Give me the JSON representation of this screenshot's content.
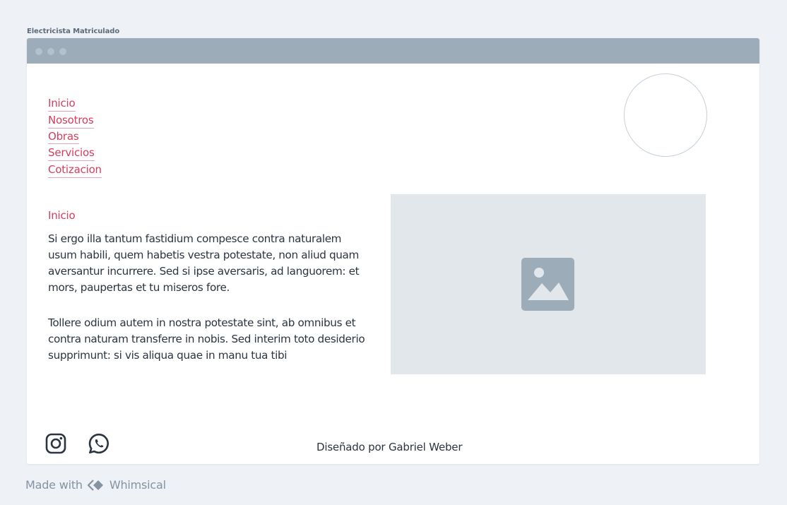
{
  "board": {
    "title": "Electricista Matriculado"
  },
  "window": {
    "titlebar_color": "#9dacb9"
  },
  "nav": {
    "items": [
      {
        "label": "Inicio"
      },
      {
        "label": "Nosotros"
      },
      {
        "label": "Obras"
      },
      {
        "label": "Servicios"
      },
      {
        "label": "Cotizacion"
      }
    ],
    "link_color": "#d63d5c"
  },
  "main": {
    "section_title": "Inicio",
    "paragraph_1": "Si ergo illa tantum fastidium compesce contra naturalem usum habili, quem habetis vestra potestate, non aliud quam aversantur incurrere. Sed si ipse aversaris, ad languorem: et mors, paupertas et tu miseros fore.",
    "paragraph_2": "Tollere odium autem in nostra potestate sint, ab omnibus et contra naturam transferre in nobis. Sed interim toto desiderio supprimunt: si vis aliqua quae in manu tua tibi",
    "image_icon": "image-placeholder-icon"
  },
  "footer": {
    "instagram_icon": "instagram-icon",
    "whatsapp_icon": "whatsapp-icon",
    "credit": "Diseñado por Gabriel Weber"
  },
  "app_footer": {
    "made_with": "Made with",
    "brand": "Whimsical"
  }
}
